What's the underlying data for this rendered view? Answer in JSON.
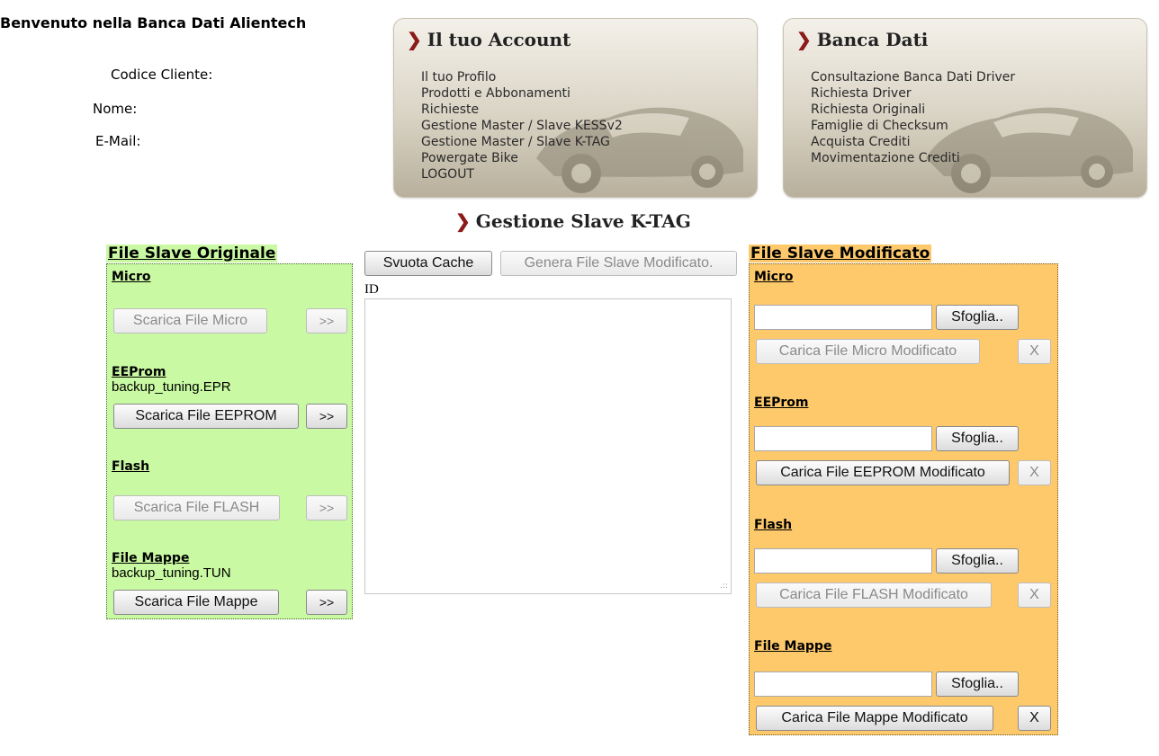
{
  "header": {
    "welcome": "Benvenuto nella Banca Dati Alientech",
    "client_code_label": "Codice Cliente:",
    "name_label": "Nome:",
    "email_label": "E-Mail:"
  },
  "account_panel": {
    "title": "Il tuo Account",
    "items": [
      "Il tuo Profilo",
      "Prodotti e Abbonamenti",
      "Richieste",
      "Gestione Master / Slave KESSv2",
      "Gestione Master / Slave K-TAG",
      "Powergate Bike",
      "LOGOUT"
    ]
  },
  "database_panel": {
    "title": "Banca Dati",
    "items": [
      "Consultazione Banca Dati Driver",
      "Richiesta Driver",
      "Richiesta Originali",
      "Famiglie di Checksum",
      "Acquista Crediti",
      "Movimentazione Crediti"
    ]
  },
  "section_title": "Gestione Slave K-TAG",
  "toolbar": {
    "clear_cache": "Svuota Cache",
    "generate": "Genera File Slave Modificato.",
    "id_label": "ID"
  },
  "original": {
    "title": "File Slave Originale",
    "micro": {
      "label": "Micro",
      "download": "Scarica File Micro",
      "arrow": ">>"
    },
    "eeprom": {
      "label": "EEProm",
      "filename": "backup_tuning.EPR",
      "download": "Scarica File EEPROM",
      "arrow": ">>"
    },
    "flash": {
      "label": "Flash",
      "download": "Scarica File FLASH",
      "arrow": ">>"
    },
    "maps": {
      "label": "File Mappe",
      "filename": "backup_tuning.TUN",
      "download": "Scarica File Mappe",
      "arrow": ">>"
    }
  },
  "modified": {
    "title": "File Slave Modificato",
    "browse": "Sfoglia..",
    "remove": "X",
    "micro": {
      "label": "Micro",
      "upload": "Carica File Micro Modificato"
    },
    "eeprom": {
      "label": "EEProm",
      "upload": "Carica File EEPROM Modificato"
    },
    "flash": {
      "label": "Flash",
      "upload": "Carica File FLASH Modificato"
    },
    "maps": {
      "label": "File Mappe",
      "upload": "Carica File Mappe Modificato"
    }
  },
  "colors": {
    "original_bg": "#c9f9a2",
    "modified_bg": "#fdc96b",
    "chevron": "#8b1a1a"
  }
}
